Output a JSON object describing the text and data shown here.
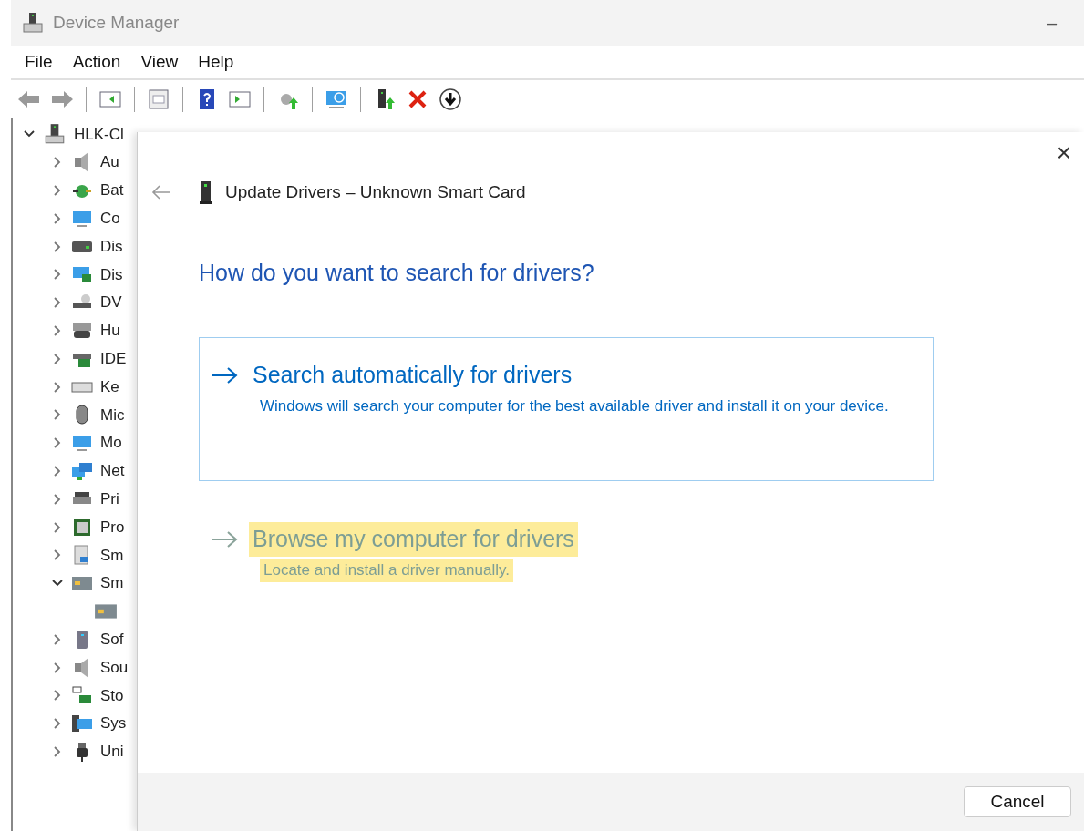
{
  "window": {
    "title": "Device Manager",
    "minimize": "–"
  },
  "menu": [
    "File",
    "Action",
    "View",
    "Help"
  ],
  "tree": {
    "label": "HLK-Cl",
    "expanded": true,
    "children": [
      {
        "label": "Au",
        "expanded": false
      },
      {
        "label": "Bat",
        "expanded": false
      },
      {
        "label": "Co",
        "expanded": false
      },
      {
        "label": "Dis",
        "expanded": false
      },
      {
        "label": "Dis",
        "expanded": false
      },
      {
        "label": "DV",
        "expanded": false
      },
      {
        "label": "Hu",
        "expanded": false
      },
      {
        "label": "IDE",
        "expanded": false
      },
      {
        "label": "Ke",
        "expanded": false
      },
      {
        "label": "Mic",
        "expanded": false
      },
      {
        "label": "Mo",
        "expanded": false
      },
      {
        "label": "Net",
        "expanded": false
      },
      {
        "label": "Pri",
        "expanded": false
      },
      {
        "label": "Pro",
        "expanded": false
      },
      {
        "label": "Sm",
        "expanded": false
      },
      {
        "label": "Sm",
        "expanded": true,
        "children": [
          {
            "kind": "device"
          }
        ]
      },
      {
        "label": "Sof",
        "expanded": false
      },
      {
        "label": "Sou",
        "expanded": false
      },
      {
        "label": "Sto",
        "expanded": false
      },
      {
        "label": "Sys",
        "expanded": false
      },
      {
        "label": "Uni",
        "expanded": false
      }
    ]
  },
  "dialog": {
    "close": "×",
    "title": "Update Drivers – Unknown Smart Card",
    "heading": "How do you want to search for drivers?",
    "options": [
      {
        "title": "Search automatically for drivers",
        "description": "Windows will search your computer for the best available driver and install it on your device.",
        "focused": true,
        "highlighted": false
      },
      {
        "title": "Browse my computer for drivers",
        "description": "Locate and install a driver manually.",
        "focused": false,
        "highlighted": true
      }
    ],
    "cancel": "Cancel"
  }
}
